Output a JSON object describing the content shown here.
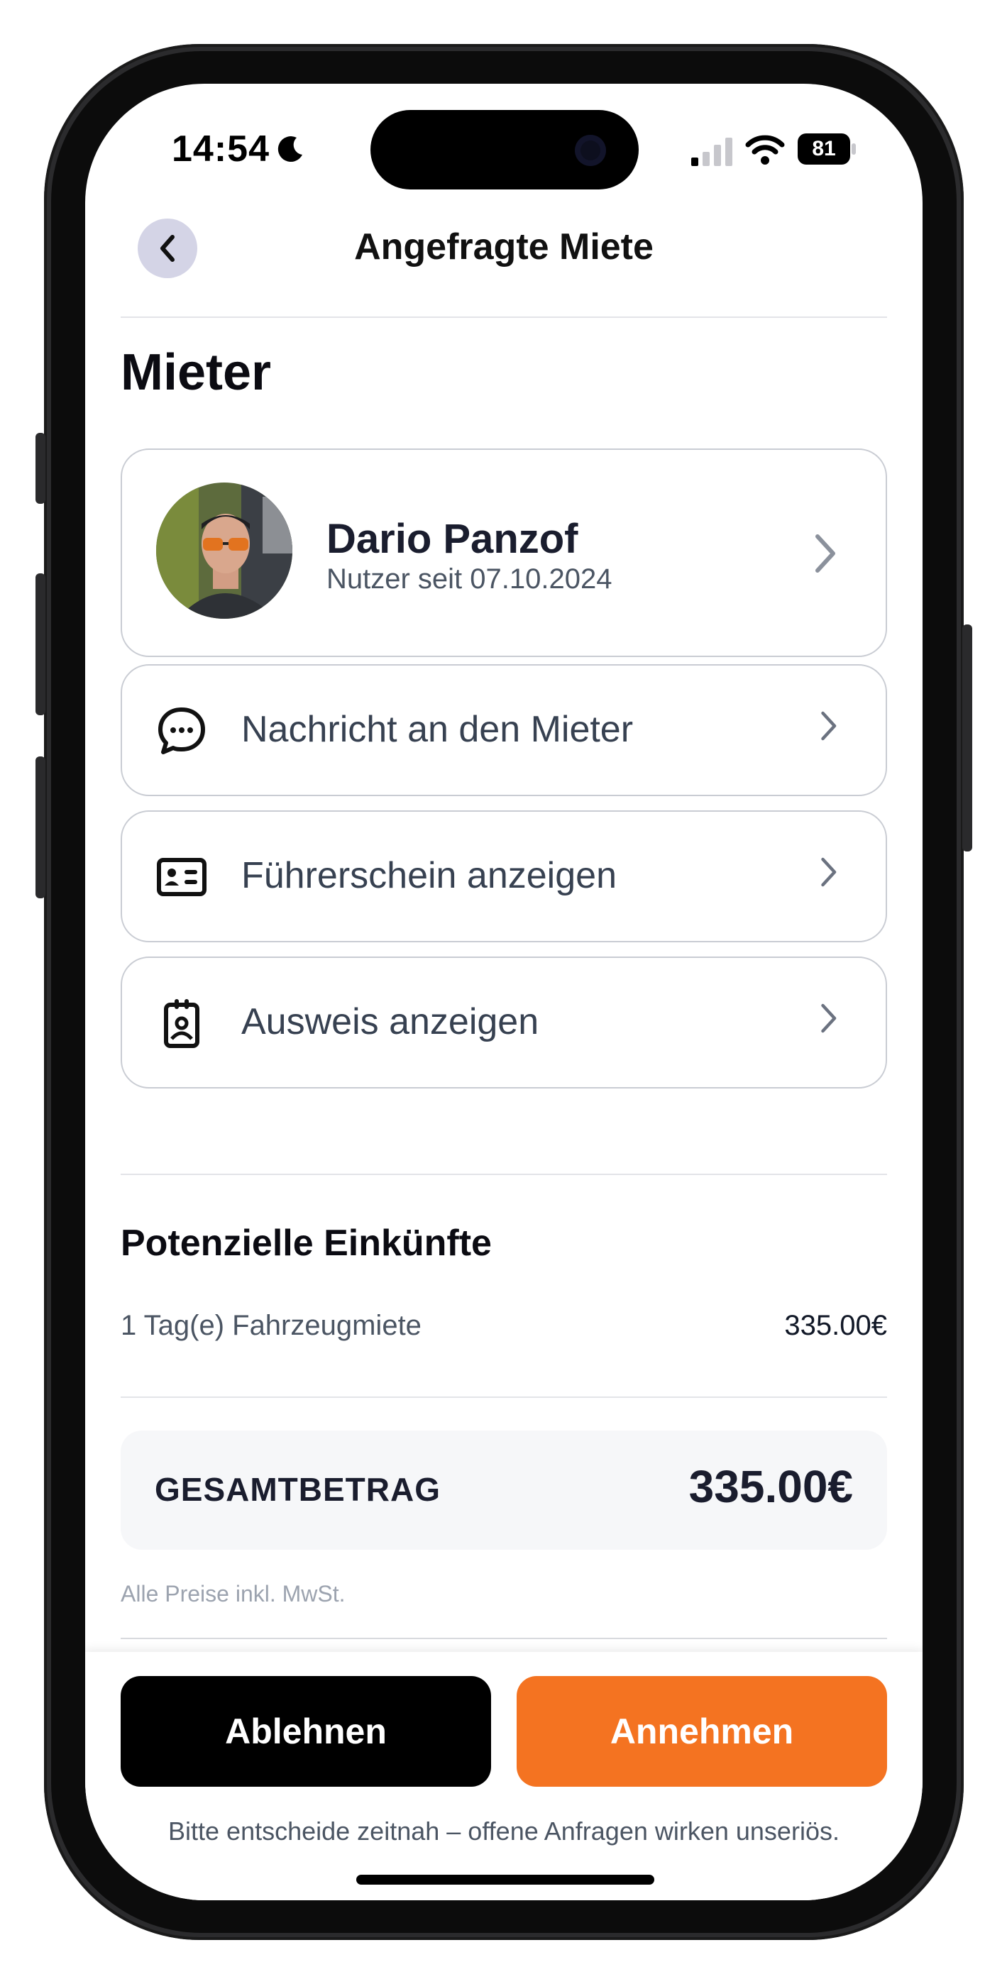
{
  "status_bar": {
    "time": "14:54",
    "battery": "81"
  },
  "header": {
    "title": "Angefragte Miete"
  },
  "tenant": {
    "section_title": "Mieter",
    "name": "Dario Panzof",
    "member_since": "Nutzer seit 07.10.2024"
  },
  "actions": [
    {
      "label": "Nachricht an den Mieter",
      "icon": "chat-bubble-icon"
    },
    {
      "label": "Führerschein anzeigen",
      "icon": "id-card-icon"
    },
    {
      "label": "Ausweis anzeigen",
      "icon": "badge-icon"
    }
  ],
  "earnings": {
    "section_title": "Potenzielle Einkünfte",
    "line_label": "1 Tag(e) Fahrzeugmiete",
    "line_value": "335.00€",
    "total_label": "GESAMTBETRAG",
    "total_value": "335.00€",
    "note": "Alle Preise inkl. MwSt."
  },
  "footer": {
    "decline_label": "Ablehnen",
    "accept_label": "Annehmen",
    "hint": "Bitte entscheide zeitnah – offene Anfragen wirken unseriös."
  },
  "colors": {
    "accent": "#f47321",
    "decline": "#000000",
    "back_button": "#d4d4e6"
  }
}
